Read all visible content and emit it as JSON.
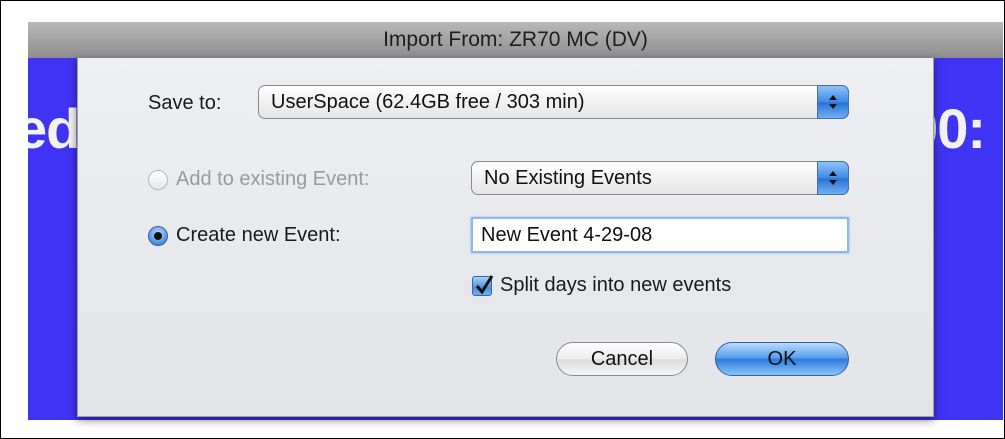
{
  "window": {
    "title": "Import From: ZR70 MC (DV)"
  },
  "background": {
    "left_fragment": "ed",
    "right_fragment": "00:",
    "color": "#3f33f4"
  },
  "dialog": {
    "save_to": {
      "label": "Save to:",
      "value": "UserSpace (62.4GB free / 303 min)"
    },
    "add_existing": {
      "label": "Add to existing Event:",
      "selected": false,
      "enabled": false,
      "value": "No Existing Events"
    },
    "create_new": {
      "label": "Create new Event:",
      "selected": true,
      "value": "New Event 4-29-08"
    },
    "split_days": {
      "label": "Split days into new events",
      "checked": true
    },
    "buttons": {
      "cancel": "Cancel",
      "ok": "OK"
    }
  },
  "icons": {
    "stepper": "popup-arrows-icon",
    "checkmark": "checkmark-icon"
  },
  "colors": {
    "accent": "#3f8ae3",
    "sheet": "#e8e9ec"
  }
}
